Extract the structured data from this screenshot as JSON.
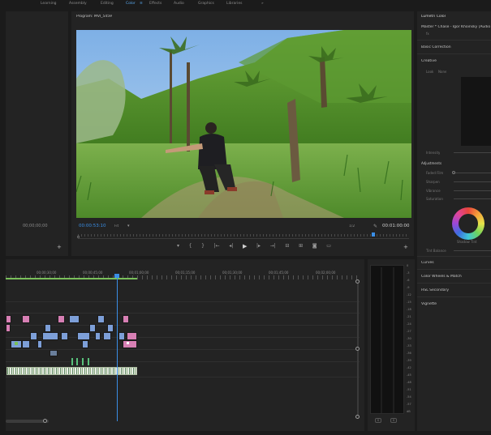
{
  "workspaces": [
    "Learning",
    "Assembly",
    "Editing",
    "Color",
    "Effects",
    "Audio",
    "Graphics",
    "Libraries",
    "»"
  ],
  "active_workspace": "Color",
  "source_monitor": {
    "timecode": "00;00;00;00"
  },
  "program_monitor": {
    "title": "Program: MVI_5459",
    "timecode_current": "00:00:53:10",
    "fit": "Fit",
    "quality": "1/2",
    "timecode_total": "00:01:00:00",
    "controls": [
      "marker",
      "in",
      "out",
      "go-to-in",
      "step-back",
      "play",
      "step-forward",
      "go-to-out",
      "lift",
      "extract",
      "export-frame",
      "compare"
    ]
  },
  "lumetri": {
    "title": "Lumetri Color",
    "clip_label": "Master * Chase - Igor Khoinsky [Audio Li...",
    "sections": [
      "Basic Correction",
      "Creative",
      "Curves",
      "Color Wheels & Match",
      "HSL Secondary",
      "Vignette"
    ],
    "creative_tabs": [
      "Look",
      "None"
    ],
    "intensity_label": "Intensity",
    "adjustments_label": "Adjustments",
    "sliders": [
      "Faded Film",
      "Sharpen",
      "Vibrance",
      "Saturation"
    ],
    "shadow_tint_label": "Shadow Tint",
    "tint_balance_label": "Tint Balance"
  },
  "timeline": {
    "ruler_labels": [
      "00;00;30;00",
      "00;00;45;00",
      "00;01;00;00",
      "00;01;15;00",
      "00;01;30;00",
      "00;01;45;00",
      "00;02;00;00"
    ]
  },
  "audio_meter": {
    "scale": [
      "0",
      "-3",
      "-6",
      "-9",
      "-12",
      "-15",
      "-18",
      "-21",
      "-24",
      "-27",
      "-30",
      "-33",
      "-36",
      "-39",
      "-42",
      "-45",
      "-48",
      "-51",
      "-54",
      "-57",
      "dB"
    ],
    "solo_buttons": [
      "S",
      "S"
    ]
  },
  "colors": {
    "accent": "#3a8ee6",
    "video_clip": "#7d9fd8",
    "pink_clip": "#d77fb4",
    "work_area": "#7abf5a"
  }
}
